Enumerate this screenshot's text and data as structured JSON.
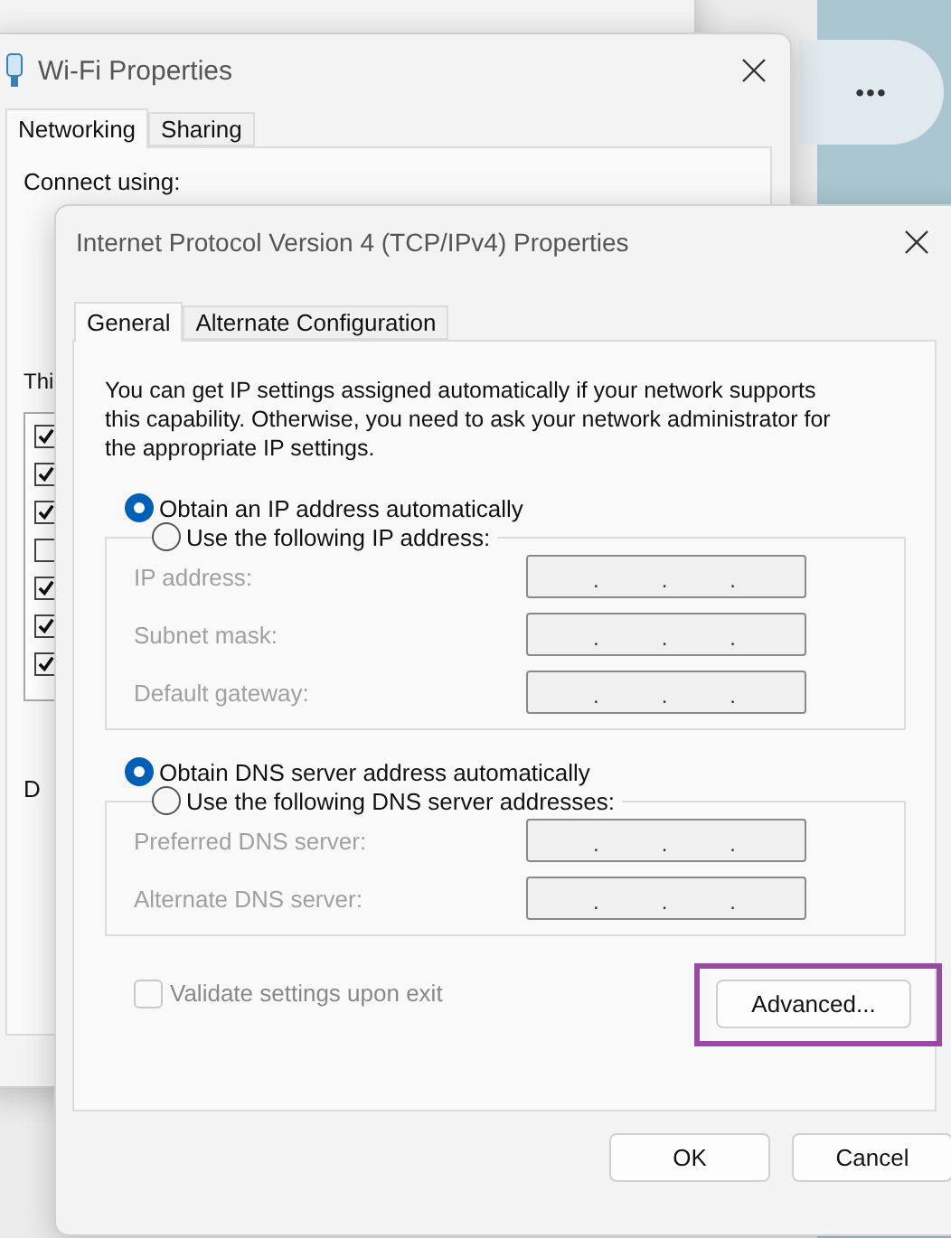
{
  "desktop": {
    "more_button": "•••"
  },
  "properties_window": {
    "title": "Wi-Fi Properties",
    "tabs": [
      {
        "label": "Networking",
        "selected": true
      },
      {
        "label": "Sharing",
        "selected": false
      }
    ],
    "connect_label": "Connect using:",
    "list_label": "Thi",
    "items": [
      {
        "checked": true
      },
      {
        "checked": true
      },
      {
        "checked": true
      },
      {
        "checked": false
      },
      {
        "checked": true
      },
      {
        "checked": true
      },
      {
        "checked": true
      }
    ],
    "group_label": "D"
  },
  "dialog": {
    "title": "Internet Protocol Version 4 (TCP/IPv4) Properties",
    "tabs": [
      {
        "label": "General",
        "selected": true
      },
      {
        "label": "Alternate Configuration",
        "selected": false
      }
    ],
    "description": "You can get IP settings assigned automatically if your network supports this capability. Otherwise, you need to ask your network administrator for the appropriate IP settings.",
    "ip_auto": {
      "label": "Obtain an IP address automatically",
      "selected": true
    },
    "ip_manual": {
      "label": "Use the following IP address:",
      "selected": false,
      "fields": [
        {
          "label": "IP address:",
          "disabled": true,
          "separators": [
            ".",
            ".",
            "."
          ]
        },
        {
          "label": "Subnet mask:",
          "disabled": true,
          "separators": [
            ".",
            ".",
            "."
          ]
        },
        {
          "label": "Default gateway:",
          "disabled": true,
          "separators": [
            ".",
            ".",
            "."
          ]
        }
      ]
    },
    "dns_auto": {
      "label": "Obtain DNS server address automatically",
      "selected": true
    },
    "dns_manual": {
      "label": "Use the following DNS server addresses:",
      "selected": false,
      "fields": [
        {
          "label": "Preferred DNS server:",
          "disabled": true,
          "separators": [
            ".",
            ".",
            "."
          ]
        },
        {
          "label": "Alternate DNS server:",
          "disabled": true,
          "separators": [
            ".",
            ".",
            "."
          ]
        }
      ]
    },
    "validate": {
      "label": "Validate settings upon exit",
      "checked": false,
      "disabled": true
    },
    "advanced_button": {
      "label": "Advanced...",
      "highlighted": true
    },
    "buttons": [
      "OK",
      "Cancel"
    ]
  }
}
